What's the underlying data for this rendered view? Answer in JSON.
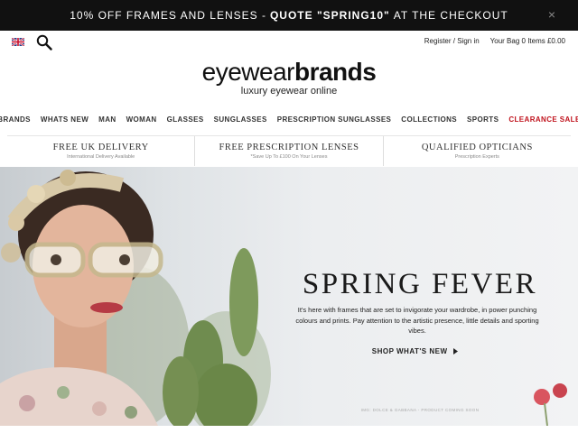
{
  "promo": {
    "prefix": "10% OFF FRAMES AND LENSES - ",
    "code": "QUOTE \"SPRING10\"",
    "suffix": " AT THE CHECKOUT",
    "close": "×"
  },
  "header": {
    "register": "Register / Sign in",
    "bag": "Your Bag 0 Items £0.00"
  },
  "logo": {
    "part1": "eyewear",
    "part2": "brands",
    "tagline": "luxury eyewear online"
  },
  "nav": {
    "items": [
      "BRANDS",
      "WHATS NEW",
      "MAN",
      "WOMAN",
      "GLASSES",
      "SUNGLASSES",
      "PRESCRIPTION SUNGLASSES",
      "COLLECTIONS",
      "SPORTS",
      "CLEARANCE SALE"
    ],
    "sale_color": "#c0121c"
  },
  "usp": [
    {
      "title": "FREE UK DELIVERY",
      "sub": "International Delivery Available"
    },
    {
      "title": "FREE PRESCRIPTION LENSES",
      "sub": "*Save Up To £100 On Your Lenses"
    },
    {
      "title": "QUALIFIED OPTICIANS",
      "sub": "Prescription Experts"
    }
  ],
  "hero": {
    "headline": "SPRING FEVER",
    "body": "It's here with frames that are set to invigorate your wardrobe, in power punching colours and prints. Pay attention to the artistic presence, little details and sporting vibes.",
    "cta": "SHOP WHAT'S NEW",
    "credit": "IMG: DOLCE & GABBANA - PRODUCT COMING SOON"
  }
}
